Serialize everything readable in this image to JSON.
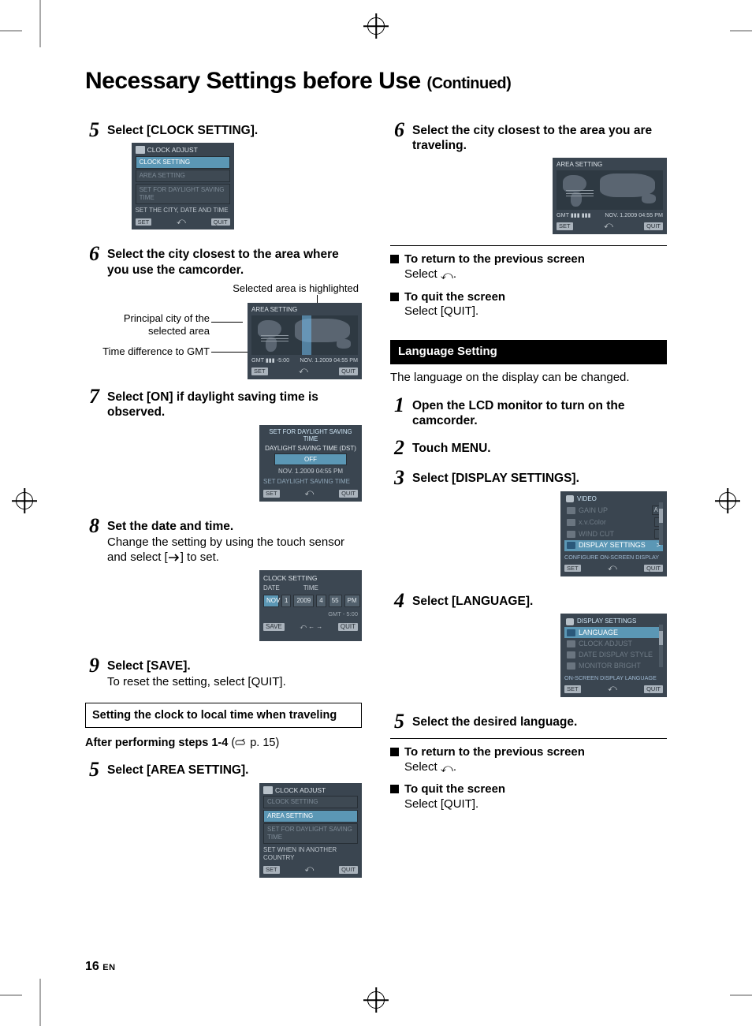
{
  "page_title_main": "Necessary Settings before Use",
  "page_title_sub": "(Continued)",
  "page_number": "16",
  "page_lang": "EN",
  "left": {
    "step5": {
      "num": "5",
      "title": "Select [CLOCK SETTING]."
    },
    "ui5": {
      "title": "CLOCK ADJUST",
      "items": [
        "CLOCK SETTING",
        "AREA SETTING",
        "SET FOR DAYLIGHT SAVING TIME"
      ],
      "hint": "SET THE CITY, DATE AND TIME",
      "set": "SET",
      "quit": "QUIT"
    },
    "step6": {
      "num": "6",
      "title": "Select the city closest to the area where you use the camcorder."
    },
    "labels6": {
      "top": "Selected area is highlighted",
      "mid": "Principal city of the selected area",
      "bot": "Time difference to GMT"
    },
    "ui6": {
      "title": "AREA SETTING",
      "gmt": "GMT",
      "bars": "-5:00",
      "stamp": "NOV. 1.2009   04:55 PM",
      "set": "SET",
      "quit": "QUIT"
    },
    "step7": {
      "num": "7",
      "title": "Select [ON] if daylight saving time is observed."
    },
    "ui7": {
      "title": "SET FOR DAYLIGHT SAVING TIME",
      "headline": "DAYLIGHT SAVING TIME (DST)",
      "off": "OFF",
      "stamp": "NOV. 1.2009   04:55 PM",
      "hint": "SET DAYLIGHT SAVING TIME",
      "set": "SET",
      "quit": "QUIT"
    },
    "step8": {
      "num": "8",
      "title": "Set the date and time.",
      "desc_a": "Change the setting by using the touch sensor and select [",
      "desc_b": "] to set."
    },
    "ui8": {
      "title": "CLOCK SETTING",
      "h1": "DATE",
      "h2": "TIME",
      "cells": [
        "NOV",
        "1",
        "2009",
        "4",
        "55",
        "PM"
      ],
      "gmt": "GMT   - 5:00",
      "save": "SAVE",
      "quit": "QUIT"
    },
    "step9": {
      "num": "9",
      "title": "Select [SAVE].",
      "desc": "To reset the setting, select [QUIT]."
    },
    "box": "Setting the clock to local time when traveling",
    "after_a": "After performing steps ",
    "after_b": "1-4",
    "after_c": " (",
    "after_d": " p. 15)",
    "step5b": {
      "num": "5",
      "title": "Select [AREA SETTING]."
    },
    "ui5b": {
      "title": "CLOCK ADJUST",
      "items": [
        "CLOCK SETTING",
        "AREA SETTING",
        "SET FOR DAYLIGHT SAVING TIME"
      ],
      "hint": "SET WHEN IN ANOTHER COUNTRY",
      "set": "SET",
      "quit": "QUIT"
    }
  },
  "right": {
    "step6": {
      "num": "6",
      "title": "Select the city closest to the area you are traveling."
    },
    "ui6": {
      "title": "AREA SETTING",
      "gmt": "GMT",
      "bars": "-5:00",
      "stamp": "NOV. 1.2009   04:55 PM",
      "set": "SET",
      "quit": "QUIT"
    },
    "note1": {
      "t": "To return to the previous screen",
      "b": "Select ",
      "b2": "."
    },
    "note2": {
      "t": "To quit the screen",
      "b": "Select [QUIT]."
    },
    "section": "Language Setting",
    "lang_para": "The language on the display can be changed.",
    "l1": {
      "num": "1",
      "title": "Open the LCD monitor to turn on the camcorder."
    },
    "l2": {
      "num": "2",
      "title": "Touch MENU."
    },
    "l3": {
      "num": "3",
      "title": "Select [DISPLAY SETTINGS]."
    },
    "ui_l3": {
      "cat": "VIDEO",
      "rows": [
        {
          "label": "GAIN UP",
          "val": "A"
        },
        {
          "label": "x.v.Color",
          "val": ""
        },
        {
          "label": "WIND CUT",
          "val": ""
        },
        {
          "label": "DISPLAY SETTINGS",
          "chev": ">"
        }
      ],
      "hint": "CONFIGURE ON-SCREEN DISPLAY",
      "set": "SET",
      "quit": "QUIT"
    },
    "l4": {
      "num": "4",
      "title": "Select [LANGUAGE]."
    },
    "ui_l4": {
      "title": "DISPLAY SETTINGS",
      "rows": [
        "LANGUAGE",
        "CLOCK ADJUST",
        "DATE DISPLAY STYLE",
        "MONITOR BRIGHT"
      ],
      "hint": "ON-SCREEN DISPLAY LANGUAGE",
      "set": "SET",
      "quit": "QUIT"
    },
    "l5": {
      "num": "5",
      "title": "Select the desired language."
    },
    "note3": {
      "t": "To return to the previous screen",
      "b": "Select ",
      "b2": "."
    },
    "note4": {
      "t": "To quit the screen",
      "b": "Select [QUIT]."
    }
  }
}
